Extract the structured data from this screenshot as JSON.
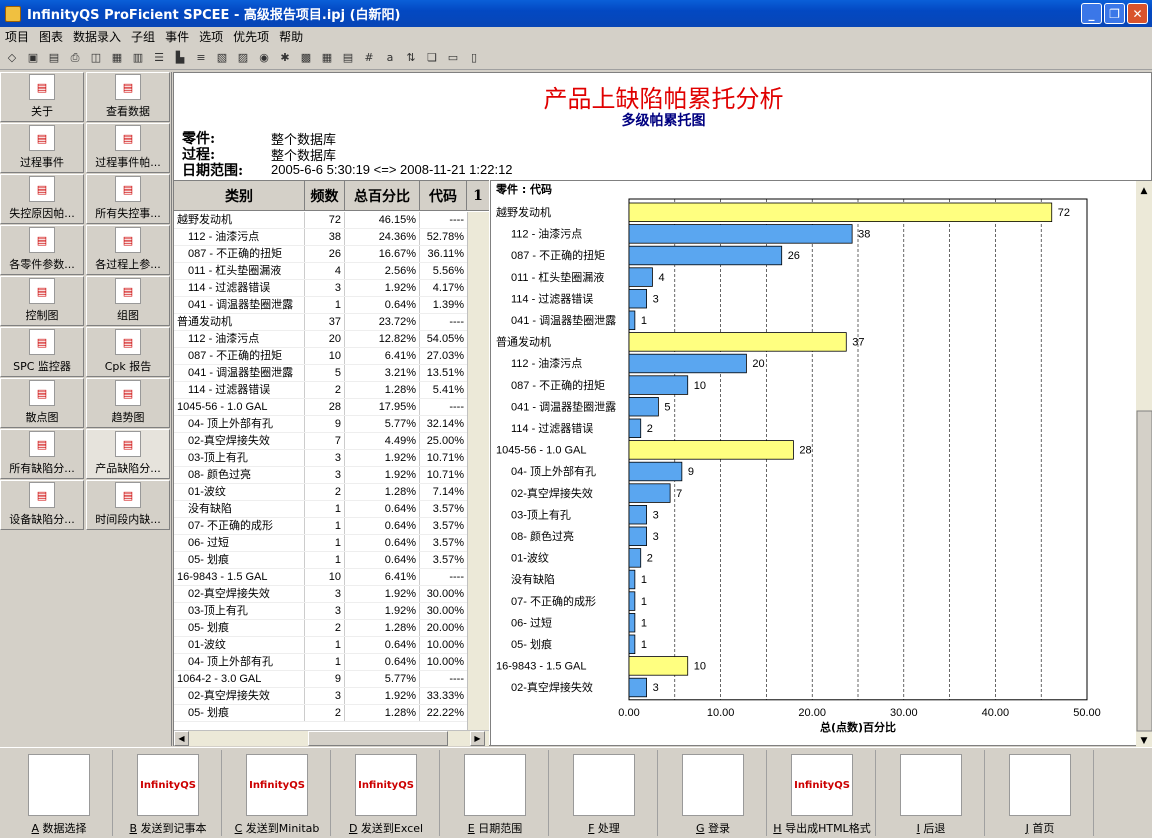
{
  "window": {
    "title": "InfinityQS ProFicient SPCEE - 高级报告项目.ipj (白新阳)"
  },
  "menu": [
    "项目",
    "图表",
    "数据录入",
    "子组",
    "事件",
    "选项",
    "优先项",
    "帮助"
  ],
  "left_buttons": [
    {
      "label": "关于",
      "icon": "about-icon"
    },
    {
      "label": "查看数据",
      "icon": "view-data-icon"
    },
    {
      "label": "过程事件",
      "icon": "process-event-icon"
    },
    {
      "label": "过程事件帕...",
      "icon": "pareto-icon"
    },
    {
      "label": "失控原因帕...",
      "icon": "pareto-icon"
    },
    {
      "label": "所有失控事...",
      "icon": "pareto-icon"
    },
    {
      "label": "各零件参数...",
      "icon": "parameter-icon"
    },
    {
      "label": "各过程上参...",
      "icon": "parameter-icon"
    },
    {
      "label": "控制图",
      "icon": "control-chart-icon"
    },
    {
      "label": "组图",
      "icon": "group-chart-icon"
    },
    {
      "label": "SPC 监控器",
      "icon": "spc-monitor-icon"
    },
    {
      "label": "Cpk 报告",
      "icon": "cpk-report-icon"
    },
    {
      "label": "散点图",
      "icon": "scatter-icon"
    },
    {
      "label": "趋势图",
      "icon": "trend-icon"
    },
    {
      "label": "所有缺陷分...",
      "icon": "pareto-icon"
    },
    {
      "label": "产品缺陷分...",
      "icon": "pareto-icon"
    },
    {
      "label": "设备缺陷分...",
      "icon": "pareto-icon"
    },
    {
      "label": "时间段内缺...",
      "icon": "pareto-icon"
    }
  ],
  "report": {
    "title": "产品上缺陷帕累托分析",
    "subtitle": "多级帕累托图",
    "part_label": "零件:",
    "part_value": "整个数据库",
    "process_label": "过程:",
    "process_value": "整个数据库",
    "date_label": "日期范围:",
    "date_value": "2005-6-6  5:30:19 <=> 2008-11-21  1:22:12"
  },
  "table": {
    "headers": [
      "类别",
      "频数",
      "总百分比",
      "代码"
    ],
    "rows": [
      {
        "name": "越野发动机",
        "freq": "72",
        "pct": "46.15%",
        "code": "----",
        "sub": false
      },
      {
        "name": "112 - 油漆污点",
        "freq": "38",
        "pct": "24.36%",
        "code": "52.78%",
        "sub": true
      },
      {
        "name": "087 - 不正确的扭矩",
        "freq": "26",
        "pct": "16.67%",
        "code": "36.11%",
        "sub": true
      },
      {
        "name": "011 - 杠头垫圈漏液",
        "freq": "4",
        "pct": "2.56%",
        "code": "5.56%",
        "sub": true
      },
      {
        "name": "114 - 过滤器错误",
        "freq": "3",
        "pct": "1.92%",
        "code": "4.17%",
        "sub": true
      },
      {
        "name": "041 - 调温器垫圈泄露",
        "freq": "1",
        "pct": "0.64%",
        "code": "1.39%",
        "sub": true
      },
      {
        "name": "普通发动机",
        "freq": "37",
        "pct": "23.72%",
        "code": "----",
        "sub": false
      },
      {
        "name": "112 - 油漆污点",
        "freq": "20",
        "pct": "12.82%",
        "code": "54.05%",
        "sub": true
      },
      {
        "name": "087 - 不正确的扭矩",
        "freq": "10",
        "pct": "6.41%",
        "code": "27.03%",
        "sub": true
      },
      {
        "name": "041 - 调温器垫圈泄露",
        "freq": "5",
        "pct": "3.21%",
        "code": "13.51%",
        "sub": true
      },
      {
        "name": "114 - 过滤器错误",
        "freq": "2",
        "pct": "1.28%",
        "code": "5.41%",
        "sub": true
      },
      {
        "name": "1045-56 - 1.0 GAL",
        "freq": "28",
        "pct": "17.95%",
        "code": "----",
        "sub": false
      },
      {
        "name": "04- 顶上外部有孔",
        "freq": "9",
        "pct": "5.77%",
        "code": "32.14%",
        "sub": true
      },
      {
        "name": "02-真空焊接失效",
        "freq": "7",
        "pct": "4.49%",
        "code": "25.00%",
        "sub": true
      },
      {
        "name": "03-顶上有孔",
        "freq": "3",
        "pct": "1.92%",
        "code": "10.71%",
        "sub": true
      },
      {
        "name": "08- 颜色过亮",
        "freq": "3",
        "pct": "1.92%",
        "code": "10.71%",
        "sub": true
      },
      {
        "name": "01-波纹",
        "freq": "2",
        "pct": "1.28%",
        "code": "7.14%",
        "sub": true
      },
      {
        "name": "没有缺陷",
        "freq": "1",
        "pct": "0.64%",
        "code": "3.57%",
        "sub": true
      },
      {
        "name": "07- 不正确的成形",
        "freq": "1",
        "pct": "0.64%",
        "code": "3.57%",
        "sub": true
      },
      {
        "name": "06- 过短",
        "freq": "1",
        "pct": "0.64%",
        "code": "3.57%",
        "sub": true
      },
      {
        "name": "05- 划痕",
        "freq": "1",
        "pct": "0.64%",
        "code": "3.57%",
        "sub": true
      },
      {
        "name": "16-9843 - 1.5 GAL",
        "freq": "10",
        "pct": "6.41%",
        "code": "----",
        "sub": false
      },
      {
        "name": "02-真空焊接失效",
        "freq": "3",
        "pct": "1.92%",
        "code": "30.00%",
        "sub": true
      },
      {
        "name": "03-顶上有孔",
        "freq": "3",
        "pct": "1.92%",
        "code": "30.00%",
        "sub": true
      },
      {
        "name": "05- 划痕",
        "freq": "2",
        "pct": "1.28%",
        "code": "20.00%",
        "sub": true
      },
      {
        "name": "01-波纹",
        "freq": "1",
        "pct": "0.64%",
        "code": "10.00%",
        "sub": true
      },
      {
        "name": "04- 顶上外部有孔",
        "freq": "1",
        "pct": "0.64%",
        "code": "10.00%",
        "sub": true
      },
      {
        "name": "1064-2 - 3.0 GAL",
        "freq": "9",
        "pct": "5.77%",
        "code": "----",
        "sub": false
      },
      {
        "name": "02-真空焊接失效",
        "freq": "3",
        "pct": "1.92%",
        "code": "33.33%",
        "sub": true
      },
      {
        "name": "05- 划痕",
        "freq": "2",
        "pct": "1.28%",
        "code": "22.22%",
        "sub": true
      }
    ]
  },
  "chart_data": {
    "type": "bar",
    "orientation": "horizontal",
    "title": "零件 : 代码",
    "xlabel": "总(点数)百分比",
    "xlim": [
      0,
      50
    ],
    "xticks": [
      "0.00",
      "10.00",
      "20.00",
      "30.00",
      "40.00",
      "50.00"
    ],
    "grid": true,
    "colors": {
      "group": "#ffff80",
      "item": "#5aa6f0"
    },
    "bars": [
      {
        "label": "越野发动机",
        "value": 46.15,
        "count": "72",
        "group": true
      },
      {
        "label": "112 - 油漆污点",
        "value": 24.36,
        "count": "38",
        "group": false
      },
      {
        "label": "087 - 不正确的扭矩",
        "value": 16.67,
        "count": "26",
        "group": false
      },
      {
        "label": "011 - 杠头垫圈漏液",
        "value": 2.56,
        "count": "4",
        "group": false
      },
      {
        "label": "114 - 过滤器错误",
        "value": 1.92,
        "count": "3",
        "group": false
      },
      {
        "label": "041 - 调温器垫圈泄露",
        "value": 0.64,
        "count": "1",
        "group": false
      },
      {
        "label": "普通发动机",
        "value": 23.72,
        "count": "37",
        "group": true
      },
      {
        "label": "112 - 油漆污点",
        "value": 12.82,
        "count": "20",
        "group": false
      },
      {
        "label": "087 - 不正确的扭矩",
        "value": 6.41,
        "count": "10",
        "group": false
      },
      {
        "label": "041 - 调温器垫圈泄露",
        "value": 3.21,
        "count": "5",
        "group": false
      },
      {
        "label": "114 - 过滤器错误",
        "value": 1.28,
        "count": "2",
        "group": false
      },
      {
        "label": "1045-56 - 1.0 GAL",
        "value": 17.95,
        "count": "28",
        "group": true
      },
      {
        "label": "04- 顶上外部有孔",
        "value": 5.77,
        "count": "9",
        "group": false
      },
      {
        "label": "02-真空焊接失效",
        "value": 4.49,
        "count": "7",
        "group": false
      },
      {
        "label": "03-顶上有孔",
        "value": 1.92,
        "count": "3",
        "group": false
      },
      {
        "label": "08- 颜色过亮",
        "value": 1.92,
        "count": "3",
        "group": false
      },
      {
        "label": "01-波纹",
        "value": 1.28,
        "count": "2",
        "group": false
      },
      {
        "label": "没有缺陷",
        "value": 0.64,
        "count": "1",
        "group": false
      },
      {
        "label": "07- 不正确的成形",
        "value": 0.64,
        "count": "1",
        "group": false
      },
      {
        "label": "06- 过短",
        "value": 0.64,
        "count": "1",
        "group": false
      },
      {
        "label": "05- 划痕",
        "value": 0.64,
        "count": "1",
        "group": false
      },
      {
        "label": "16-9843 - 1.5 GAL",
        "value": 6.41,
        "count": "10",
        "group": true
      },
      {
        "label": "02-真空焊接失效",
        "value": 1.92,
        "count": "3",
        "group": false
      }
    ]
  },
  "bottom_buttons": [
    {
      "key": "A",
      "label": "数据选择",
      "icon": "binoculars-icon",
      "logo": ""
    },
    {
      "key": "B",
      "label": "发送到记事本",
      "icon": "notepad-icon",
      "logo": "InfinityQS"
    },
    {
      "key": "C",
      "label": "发送到Minitab",
      "icon": "minitab-icon",
      "logo": "InfinityQS"
    },
    {
      "key": "D",
      "label": "发送到Excel",
      "icon": "excel-icon",
      "logo": "InfinityQS"
    },
    {
      "key": "E",
      "label": "日期范围",
      "icon": "clock-icon",
      "logo": ""
    },
    {
      "key": "F",
      "label": "处理",
      "icon": "gears-icon",
      "logo": ""
    },
    {
      "key": "G",
      "label": "登录",
      "icon": "login-icon",
      "logo": ""
    },
    {
      "key": "H",
      "label": "导出成HTML格式",
      "icon": "html-export-icon",
      "logo": "InfinityQS"
    },
    {
      "key": "I",
      "label": "后退",
      "icon": "back-arrow-icon",
      "logo": ""
    },
    {
      "key": "J",
      "label": "首页",
      "icon": "home-icon",
      "logo": ""
    }
  ]
}
